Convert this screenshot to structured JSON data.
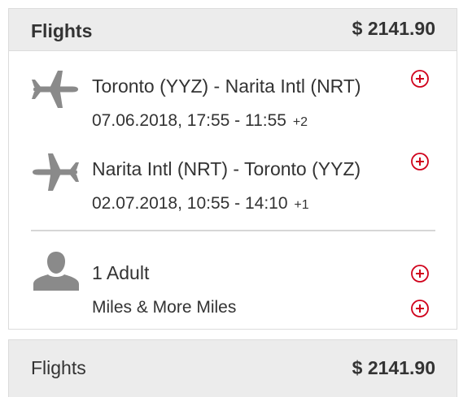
{
  "card": {
    "title": "Flights",
    "price": "$ 2141.90"
  },
  "flights": [
    {
      "route": "Toronto (YYZ) - Narita Intl (NRT)",
      "times": "07.06.2018, 17:55 - 11:55",
      "day_offset": "+2",
      "icon": "plane-departure-icon"
    },
    {
      "route": "Narita Intl (NRT) - Toronto (YYZ)",
      "times": "02.07.2018, 10:55 - 14:10",
      "day_offset": "+1",
      "icon": "plane-return-icon"
    }
  ],
  "passengers": {
    "label": "1 Adult",
    "miles_label": "Miles & More Miles",
    "icon": "person-icon"
  },
  "summary": {
    "title": "Flights",
    "price": "$ 2141.90"
  },
  "colors": {
    "accent": "#d0021b",
    "icon_gray": "#8a8a8a",
    "header_bg": "#ececec"
  }
}
